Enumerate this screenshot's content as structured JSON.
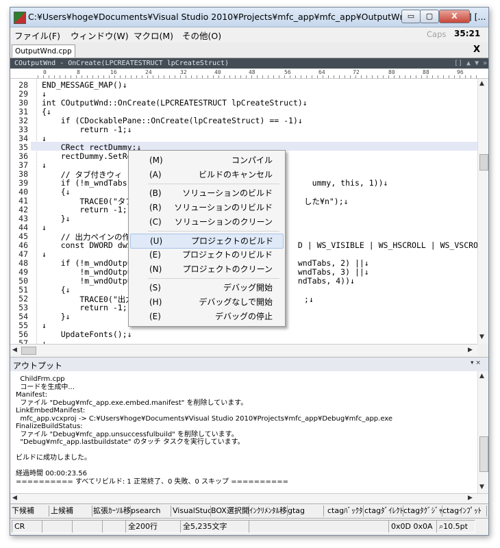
{
  "window": {
    "title": "C:¥Users¥hoge¥Documents¥Visual Studio 2010¥Projects¥mfc_app¥mfc_app¥OutputWnd.cpp  [Shift-JIS] [...",
    "min_label": "▭",
    "max_label": "▢",
    "close_label": "X"
  },
  "menubar": {
    "items": [
      "ファイル(F)",
      "ウィンドウ(W)",
      "マクロ(M)",
      "その他(O)"
    ],
    "caps": "Caps",
    "cursor_pos": "35:21"
  },
  "tabs": {
    "file_tab": "OutputWnd.cpp",
    "close": "X"
  },
  "function_bar": {
    "text": "COutputWnd - OnCreate(LPCREATESTRUCT lpCreateStruct)",
    "icons": "[] ▲ ▼ »"
  },
  "ruler": {
    "marks": [
      "0",
      "8",
      "16",
      "24",
      "32",
      "40",
      "48",
      "56",
      "64",
      "72",
      "80",
      "88",
      "96"
    ]
  },
  "editor": {
    "lines": [
      {
        "n": "28",
        "t": "END_MESSAGE_MAP()↓"
      },
      {
        "n": "29",
        "t": "↓"
      },
      {
        "n": "30",
        "t": "int COutputWnd::OnCreate(LPCREATESTRUCT lpCreateStruct)↓"
      },
      {
        "n": "31",
        "t": "{↓"
      },
      {
        "n": "32",
        "t": "    if (CDockablePane::OnCreate(lpCreateStruct) == -1)↓"
      },
      {
        "n": "33",
        "t": "        return -1;↓"
      },
      {
        "n": "34",
        "t": "↓"
      },
      {
        "n": "35",
        "t": "    CRect rectDummy;↓"
      },
      {
        "n": "36",
        "t": "    rectDummy.SetRec"
      },
      {
        "n": "37",
        "t": "↓"
      },
      {
        "n": "38",
        "t": "    // タブ付きウィ"
      },
      {
        "n": "39",
        "t": "    if (!m_wndTabs.C                                     ummy, this, 1))↓"
      },
      {
        "n": "40",
        "t": "    {↓"
      },
      {
        "n": "41",
        "t": "        TRACE0(\"タブ                                    した¥n\");↓"
      },
      {
        "n": "42",
        "t": "        return -1;"
      },
      {
        "n": "43",
        "t": "    }↓"
      },
      {
        "n": "44",
        "t": "↓"
      },
      {
        "n": "45",
        "t": "    // 出力ペインの作"
      },
      {
        "n": "46",
        "t": "    const DWORD dwSt                                  D | WS_VISIBLE | WS_HSCROLL | WS_VSCROLL;↓"
      },
      {
        "n": "47",
        "t": "↓"
      },
      {
        "n": "48",
        "t": "    if (!m_wndOutput                                  wndTabs, 2) ||↓"
      },
      {
        "n": "49",
        "t": "        !m_wndOutput                                  wndTabs, 3) ||↓"
      },
      {
        "n": "50",
        "t": "        !m_wndOutput                                  ndTabs, 4))↓"
      },
      {
        "n": "51",
        "t": "    {↓"
      },
      {
        "n": "52",
        "t": "        TRACE0(\"出力                                    ;↓"
      },
      {
        "n": "53",
        "t": "        return -1;"
      },
      {
        "n": "54",
        "t": "    }↓"
      },
      {
        "n": "55",
        "t": "↓"
      },
      {
        "n": "56",
        "t": "    UpdateFonts();↓"
      },
      {
        "n": "57",
        "t": "↓"
      }
    ]
  },
  "context_menu": {
    "items": [
      {
        "key": "(M)",
        "label": "コンパイル"
      },
      {
        "key": "(A)",
        "label": "ビルドのキャンセル"
      },
      {
        "key": "(B)",
        "label": "ソリューションのビルド"
      },
      {
        "key": "(R)",
        "label": "ソリューションのリビルド"
      },
      {
        "key": "(C)",
        "label": "ソリューションのクリーン"
      },
      {
        "key": "(U)",
        "label": "プロジェクトのビルド"
      },
      {
        "key": "(E)",
        "label": "プロジェクトのリビルド"
      },
      {
        "key": "(N)",
        "label": "プロジェクトのクリーン"
      },
      {
        "key": "(S)",
        "label": "デバッグ開始"
      },
      {
        "key": "(H)",
        "label": "デバッグなしで開始"
      },
      {
        "key": "(E)",
        "label": "デバッグの停止"
      }
    ],
    "selected_index": 5
  },
  "output": {
    "title": "アウトプット",
    "icons": "▾ ×",
    "lines": [
      "  ChildFrm.cpp",
      "  コードを生成中...",
      "Manifest:",
      "  ファイル \"Debug¥mfc_app.exe.embed.manifest\" を削除しています。",
      "LinkEmbedManifest:",
      "  mfc_app.vcxproj -> C:¥Users¥hoge¥Documents¥Visual Studio 2010¥Projects¥mfc_app¥Debug¥mfc_app.exe",
      "FinalizeBuildStatus:",
      "  ファイル \"Debug¥mfc_app.unsuccessfulbuild\" を削除しています。",
      "  \"Debug¥mfc_app.lastbuildstate\" のタッチ タスクを実行しています。",
      "",
      "ビルドに成功しました。",
      "",
      "経過時間 00:00:23.56",
      "========== すべてリビルド: 1 正常終了、0 失敗、0 スキップ =========="
    ]
  },
  "fkeys": [
    "下候補",
    "上候補",
    "拡張ｶｰｿﾙ移",
    "psearch",
    "VisualStuc",
    "BOX選択開",
    "ｲﾝｸﾘﾒﾝﾀﾙ移",
    "gtag",
    "ctagﾊﾞｯｸﾀｸ",
    "ctagﾀﾞｲﾚｸﾄ",
    "ctagﾀｸﾞｼﾞｬ",
    "ctagｲﾝﾌﾟｯﾄ"
  ],
  "statusbar": {
    "eol": "CR",
    "lines": "全200行",
    "chars": "全5,235文字",
    "code": "0x0D 0x0A",
    "zoom": "⌕10.5pt"
  }
}
